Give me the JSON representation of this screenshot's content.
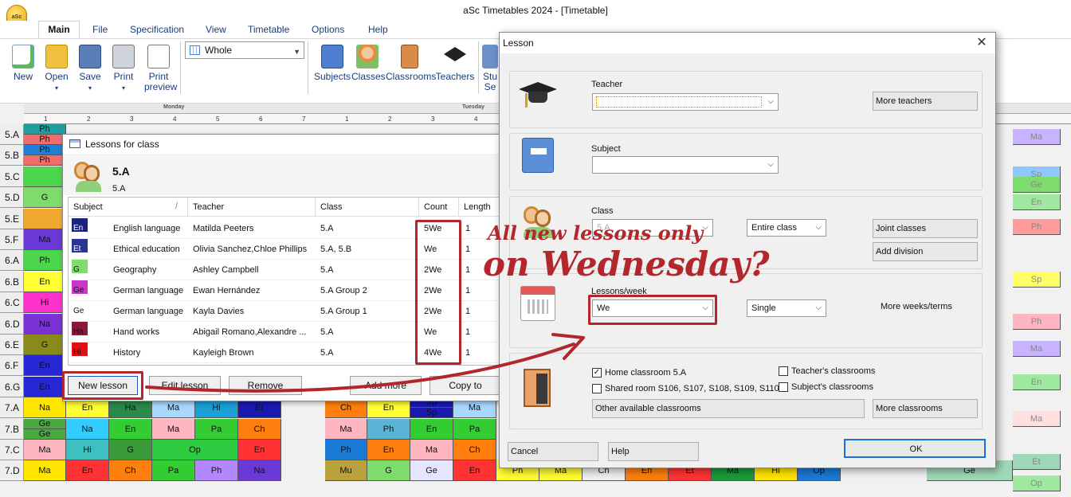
{
  "window": {
    "title": "aSc Timetables 2024  - [Timetable]"
  },
  "menu": [
    "Main",
    "File",
    "Specification",
    "View",
    "Timetable",
    "Options",
    "Help"
  ],
  "ribbon": {
    "buttons": [
      "New",
      "Open",
      "Save",
      "Print",
      "Print preview",
      "Subjects",
      "Classes",
      "Classrooms",
      "Teachers",
      "Stu Se"
    ],
    "view_select": "Whole"
  },
  "grid": {
    "days": [
      "Monday",
      "Tuesday"
    ],
    "periods": [
      "1",
      "2",
      "3",
      "4",
      "5",
      "6",
      "7"
    ],
    "rows": [
      "5.A",
      "5.B",
      "5.C",
      "5.D",
      "5.E",
      "5.F",
      "6.A",
      "6.B",
      "6.C",
      "6.D",
      "6.E",
      "6.F",
      "6.G",
      "7.A",
      "7.B",
      "7.C",
      "7.D"
    ],
    "visible_cells": {
      "r0": [
        "Ph",
        "Ph",
        "Sp"
      ],
      "r1": [
        "Ph",
        "Ph"
      ],
      "r3": [
        "G"
      ],
      "r5": [
        "Ma"
      ],
      "r6": [
        "Ph"
      ],
      "r7": [
        "En"
      ],
      "r8": [
        "Hi"
      ],
      "r9": [
        "Na"
      ],
      "r10": [
        "G"
      ],
      "r11": [
        "En"
      ],
      "r12": [
        "En"
      ],
      "r13": [
        "Na",
        "En",
        "Ha",
        "Ma",
        "Hi",
        "Et",
        "Ch",
        "En",
        "Sp",
        "Sp",
        "Ma"
      ],
      "r14": [
        "Ge",
        "Ge",
        "Na",
        "En",
        "Ma",
        "Pa",
        "Ch",
        "Ma",
        "Ph",
        "En",
        "Pa"
      ],
      "r15": [
        "Ma",
        "Hi",
        "G",
        "Op",
        "En",
        "Ph",
        "En",
        "Ma",
        "Ch"
      ],
      "r16": [
        "Ma",
        "En",
        "Ch",
        "Pa",
        "Ph",
        "Na",
        "Mu",
        "G",
        "Ge",
        "En",
        "Ph",
        "Ma",
        "Ch",
        "En",
        "Et",
        "Ma",
        "Hi",
        "Op",
        "Ge"
      ]
    },
    "right_cells": [
      "Ma",
      "Sp",
      "Ge",
      "En",
      "Ph",
      "Sp",
      "Ph",
      "Ma",
      "En",
      "Ma",
      "Et",
      "Op"
    ]
  },
  "lessons_window": {
    "title": "Lessons for class",
    "class_name": "5.A",
    "class_sub": "5.A",
    "columns": [
      "Subject",
      "/",
      "Teacher",
      "Class",
      "Count",
      "Length"
    ],
    "rows": [
      {
        "code": "En",
        "subject": "English language",
        "teacher": "Matilda Peeters",
        "class": "5.A",
        "count": "5We",
        "length": "1",
        "color": "#1a237e",
        "fg": "#ffffff"
      },
      {
        "code": "Et",
        "subject": "Ethical education",
        "teacher": "Olivia Sanchez,Chloe Phillips",
        "class": "5.A, 5.B",
        "count": "We",
        "length": "1",
        "color": "#283593",
        "fg": "#ffffff"
      },
      {
        "code": "G",
        "subject": "Geography",
        "teacher": "Ashley Campbell",
        "class": "5.A",
        "count": "2We",
        "length": "1",
        "color": "#7ddc6c",
        "fg": "#111111"
      },
      {
        "code": "Ge",
        "subject": "German language",
        "teacher": "Ewan Hernández",
        "class": "5.A Group 2",
        "count": "2We",
        "length": "1",
        "color": "#c936c9",
        "fg": "#111111"
      },
      {
        "code": "Ge",
        "subject": "German language",
        "teacher": "Kayla Davies",
        "class": "5.A Group 1",
        "count": "2We",
        "length": "1",
        "color": "#ffffff",
        "fg": "#111111"
      },
      {
        "code": "Ha",
        "subject": "Hand works",
        "teacher": "Abigail Romano,Alexandre ...",
        "class": "5.A",
        "count": "We",
        "length": "1",
        "color": "#8b1a3a",
        "fg": "#111111"
      },
      {
        "code": "Hi",
        "subject": "History",
        "teacher": "Kayleigh Brown",
        "class": "5.A",
        "count": "4We",
        "length": "1",
        "color": "#e01010",
        "fg": "#111111"
      }
    ],
    "buttons": [
      "New lesson",
      "Edit lesson",
      "Remove",
      "Add more",
      "Copy to"
    ]
  },
  "dialog": {
    "title": "Lesson",
    "close": "✕",
    "teacher_label": "Teacher",
    "teacher_value": "",
    "more_teachers": "More teachers",
    "subject_label": "Subject",
    "subject_value": "",
    "class_label": "Class",
    "class_value": "5.A",
    "class_scope": "Entire class",
    "joint_classes": "Joint classes",
    "add_division": "Add division",
    "lpw_label": "Lessons/week",
    "lpw_value": "We",
    "single": "Single",
    "more_weeks": "More weeks/terms",
    "home_classroom": "Home classroom 5.A",
    "teachers_classrooms": "Teacher's classrooms",
    "shared_room": "Shared room S106, S107, S108, S109, S110",
    "subjects_classrooms": "Subject's classrooms",
    "other_classrooms": "Other available classrooms",
    "more_classrooms": "More classrooms",
    "cancel": "Cancel",
    "help": "Help",
    "ok": "OK"
  },
  "annotation": {
    "line1": "All new lessons only",
    "line2": "on Wednesday?",
    "color": "#b3262b"
  }
}
